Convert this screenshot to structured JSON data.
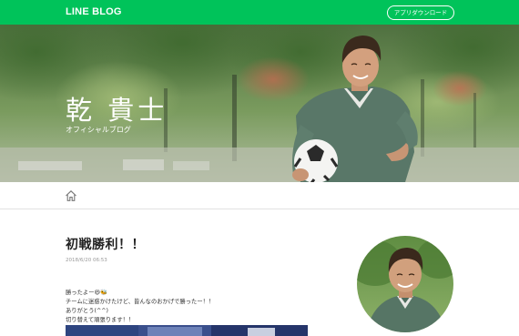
{
  "header": {
    "logo": "LINE BLOG",
    "app_download_label": "アプリダウンロード"
  },
  "hero": {
    "name": "乾 貴士",
    "subtitle": "オフィシャルブログ"
  },
  "nav": {
    "home_icon": "home-icon"
  },
  "post": {
    "title": "初戦勝利！！",
    "date": "2018/6/20 06:53",
    "lines": [
      "勝ったよー😆🐝",
      "チームに迷惑かけたけど、皆んなのおかげで勝ったー！！",
      "ありがとう(^^)",
      "切り替えて頑張ります！！"
    ]
  },
  "colors": {
    "brand_green": "#00c35a"
  }
}
